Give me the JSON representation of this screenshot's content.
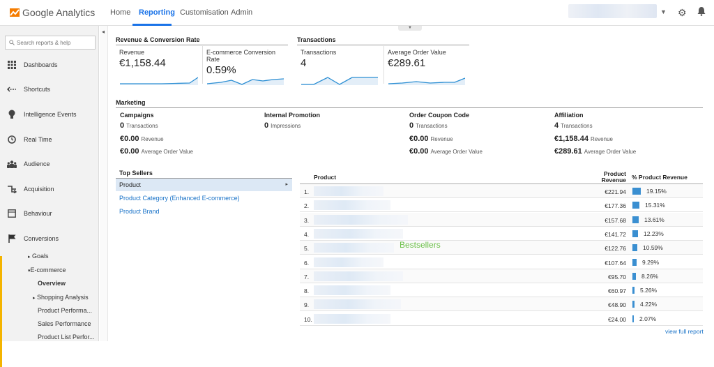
{
  "app": {
    "name": "Google Analytics"
  },
  "nav": {
    "tabs": [
      "Home",
      "Reporting",
      "Customisation",
      "Admin"
    ],
    "active": "Reporting"
  },
  "search": {
    "placeholder": "Search reports & help"
  },
  "sidebar": {
    "items": [
      {
        "label": "Dashboards",
        "icon": "grid-icon"
      },
      {
        "label": "Shortcuts",
        "icon": "shortcut-arrow-icon"
      },
      {
        "label": "Intelligence Events",
        "icon": "lightbulb-icon"
      },
      {
        "label": "Real Time",
        "icon": "clock-icon"
      },
      {
        "label": "Audience",
        "icon": "people-icon"
      },
      {
        "label": "Acquisition",
        "icon": "acquisition-arrows-icon"
      },
      {
        "label": "Behaviour",
        "icon": "page-icon"
      },
      {
        "label": "Conversions",
        "icon": "flag-icon"
      }
    ],
    "sub": {
      "goals": "Goals",
      "ecommerce": "E-commerce",
      "overview": "Overview",
      "shopping_analysis": "Shopping Analysis",
      "product_performance": "Product Performa...",
      "sales_performance": "Sales Performance",
      "product_list": "Product List Perfor..."
    }
  },
  "revenue_section": {
    "title": "Revenue & Conversion Rate",
    "metrics": [
      {
        "label": "Revenue",
        "value": "€1,158.44"
      },
      {
        "label": "E-commerce Conversion Rate",
        "value": "0.59%"
      }
    ]
  },
  "transactions_section": {
    "title": "Transactions",
    "metrics": [
      {
        "label": "Transactions",
        "value": "4"
      },
      {
        "label": "Average Order Value",
        "value": "€289.61"
      }
    ]
  },
  "marketing": {
    "title": "Marketing",
    "columns": [
      {
        "title": "Campaigns",
        "rows": [
          {
            "value": "0",
            "label": "Transactions"
          },
          {
            "value": "€0.00",
            "label": "Revenue"
          },
          {
            "value": "€0.00",
            "label": "Average Order Value"
          }
        ]
      },
      {
        "title": "Internal Promotion",
        "rows": [
          {
            "value": "0",
            "label": "Impressions"
          }
        ]
      },
      {
        "title": "Order Coupon Code",
        "rows": [
          {
            "value": "0",
            "label": "Transactions"
          },
          {
            "value": "€0.00",
            "label": "Revenue"
          },
          {
            "value": "€0.00",
            "label": "Average Order Value"
          }
        ]
      },
      {
        "title": "Affiliation",
        "rows": [
          {
            "value": "4",
            "label": "Transactions"
          },
          {
            "value": "€1,158.44",
            "label": "Revenue"
          },
          {
            "value": "€289.61",
            "label": "Average Order Value"
          }
        ]
      }
    ]
  },
  "top_sellers": {
    "title": "Top Sellers",
    "selected": "Product",
    "links": [
      "Product Category (Enhanced E-commerce)",
      "Product Brand"
    ]
  },
  "table": {
    "headers": {
      "product": "Product",
      "revenue_line1": "Product",
      "revenue_line2": "Revenue",
      "pct": "% Product Revenue"
    },
    "rows": [
      {
        "n": "1.",
        "revenue": "€221.94",
        "pct": "19.15%",
        "share": 0.1915
      },
      {
        "n": "2.",
        "revenue": "€177.36",
        "pct": "15.31%",
        "share": 0.1531
      },
      {
        "n": "3.",
        "revenue": "€157.68",
        "pct": "13.61%",
        "share": 0.1361
      },
      {
        "n": "4.",
        "revenue": "€141.72",
        "pct": "12.23%",
        "share": 0.1223
      },
      {
        "n": "5.",
        "revenue": "€122.76",
        "pct": "10.59%",
        "share": 0.1059
      },
      {
        "n": "6.",
        "revenue": "€107.64",
        "pct": "9.29%",
        "share": 0.0929
      },
      {
        "n": "7.",
        "revenue": "€95.70",
        "pct": "8.26%",
        "share": 0.0826
      },
      {
        "n": "8.",
        "revenue": "€60.97",
        "pct": "5.26%",
        "share": 0.0526
      },
      {
        "n": "9.",
        "revenue": "€48.90",
        "pct": "4.22%",
        "share": 0.0422
      },
      {
        "n": "10.",
        "revenue": "€24.00",
        "pct": "2.07%",
        "share": 0.0207
      }
    ],
    "watermark": "Bestsellers",
    "view_full": "view full report"
  },
  "colors": {
    "accent": "#1a73e8",
    "bar": "#3a8fd1",
    "sidebar_highlight": "#f4b400"
  }
}
